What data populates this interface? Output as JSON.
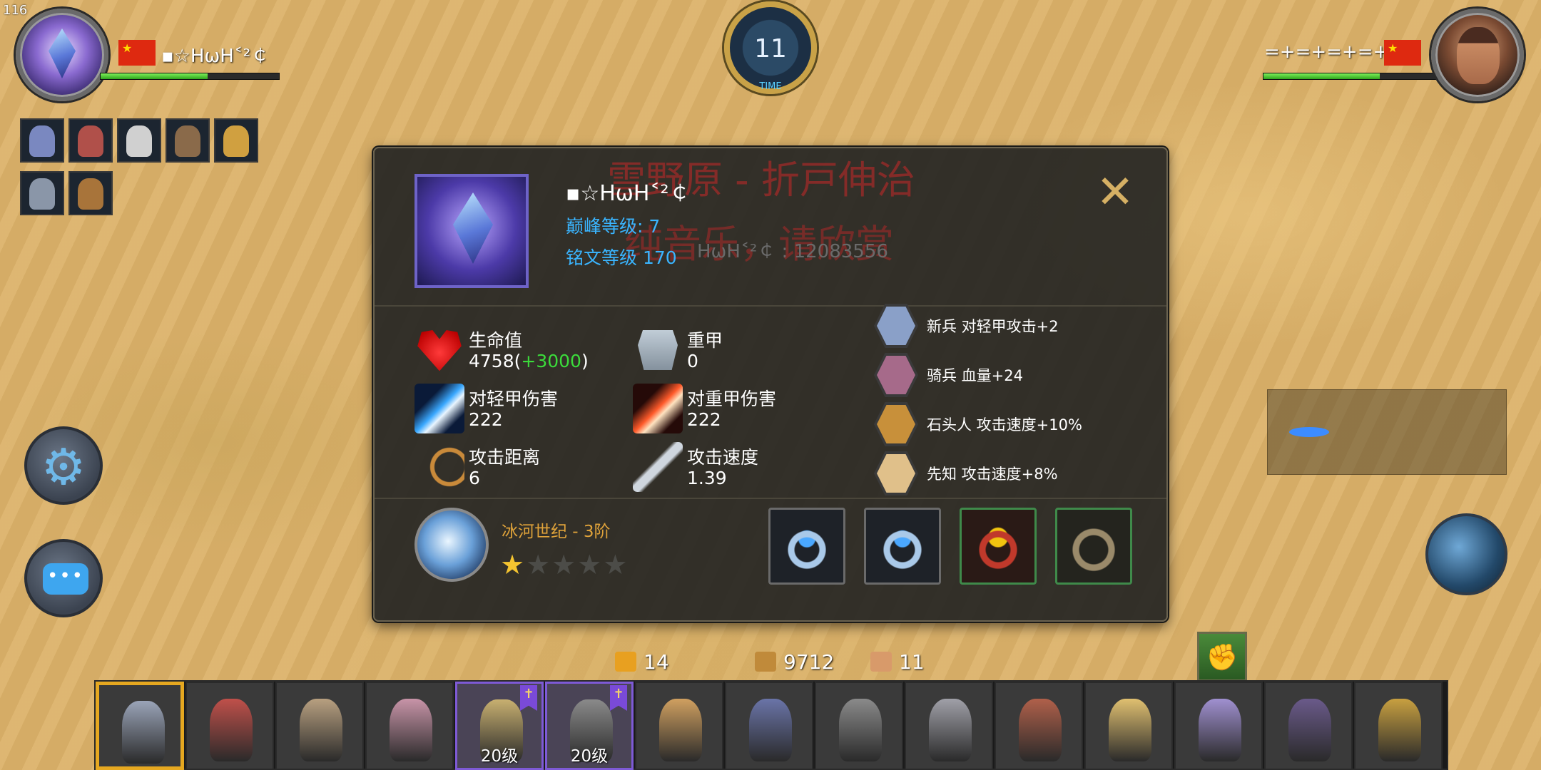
{
  "hud": {
    "fps": "116",
    "timer": {
      "value": "11",
      "label": "TIME"
    }
  },
  "player1": {
    "name": "▪☆ΗωΗ˂²￠",
    "hp_fraction": 0.6,
    "units": [
      "knight-crossbow",
      "red-rogue",
      "skeleton",
      "centaur-warrior",
      "lion-beast",
      "shield-knight",
      "stone-golem"
    ]
  },
  "player2": {
    "name": "=+=+=+=+=",
    "hp_fraction": 0.65
  },
  "dialog": {
    "player_name": "▪☆ΗωΗ˂²￠",
    "peak_level": "巅峰等级: 7",
    "rune_level": "铭文等级 170",
    "id_line": "ΗωΗ˂²￠ : 12083556",
    "watermark_line1": "雪野原 - 折戸伸治",
    "watermark_line2": "纯音乐，请欣赏",
    "close_icon": "close-icon",
    "stats": [
      {
        "icon": "heart-icon",
        "label": "生命值",
        "value": "4758(",
        "bonus": "+3000",
        "suffix": ")"
      },
      {
        "icon": "armor-icon",
        "label": "重甲",
        "value": "0"
      },
      {
        "icon": "blue-slash-icon",
        "label": "对轻甲伤害",
        "value": "222"
      },
      {
        "icon": "red-slash-icon",
        "label": "对重甲伤害",
        "value": "222"
      },
      {
        "icon": "bow-icon",
        "label": "攻击距离",
        "value": "6"
      },
      {
        "icon": "dagger-icon",
        "label": "攻击速度",
        "value": "1.39"
      }
    ],
    "buffs": [
      {
        "text": "新兵 对轻甲攻击+2",
        "color": "#8aa0c8"
      },
      {
        "text": "骑兵 血量+24",
        "color": "#a66a8a"
      },
      {
        "text": "石头人 攻击速度+10%",
        "color": "#c8903a"
      },
      {
        "text": "先知 攻击速度+8%",
        "color": "#e0c08a"
      }
    ],
    "hero": {
      "name": "冰河世纪 - 3阶",
      "stars_total": 5,
      "stars_filled": 1
    },
    "equipment": [
      "ring-blue",
      "ring-blue",
      "ring-red",
      "ring-gold"
    ]
  },
  "resources": {
    "gold": "14",
    "wood": "9712",
    "population": "11"
  },
  "unit_bar": {
    "cards": [
      {
        "unit": "knight",
        "level": "",
        "selected": true,
        "color": "#9aa4b8"
      },
      {
        "unit": "red-warrior",
        "level": "",
        "color": "#c0504a"
      },
      {
        "unit": "swordsman",
        "level": "",
        "color": "#b8a080"
      },
      {
        "unit": "mummy",
        "level": "",
        "color": "#c894a8"
      },
      {
        "unit": "paladin",
        "level": "20级",
        "elite": true,
        "color": "#c8b070"
      },
      {
        "unit": "assassin",
        "level": "20级",
        "elite": true,
        "color": "#8a8a8a"
      },
      {
        "unit": "catfolk",
        "level": "",
        "color": "#d0a060"
      },
      {
        "unit": "crossbowman",
        "level": "",
        "color": "#6a74a8"
      },
      {
        "unit": "dark-knight",
        "level": "",
        "color": "#8a8a8a"
      },
      {
        "unit": "cavalry",
        "level": "",
        "color": "#a0a0a8"
      },
      {
        "unit": "warrior-woman",
        "level": "",
        "color": "#b0604a"
      },
      {
        "unit": "gold-cavalry",
        "level": "",
        "color": "#e0c070"
      },
      {
        "unit": "prophet",
        "level": "",
        "color": "#a090d0"
      },
      {
        "unit": "mage",
        "level": "",
        "color": "#6a5a8a"
      },
      {
        "unit": "samurai",
        "level": "",
        "color": "#c8a040"
      }
    ]
  }
}
